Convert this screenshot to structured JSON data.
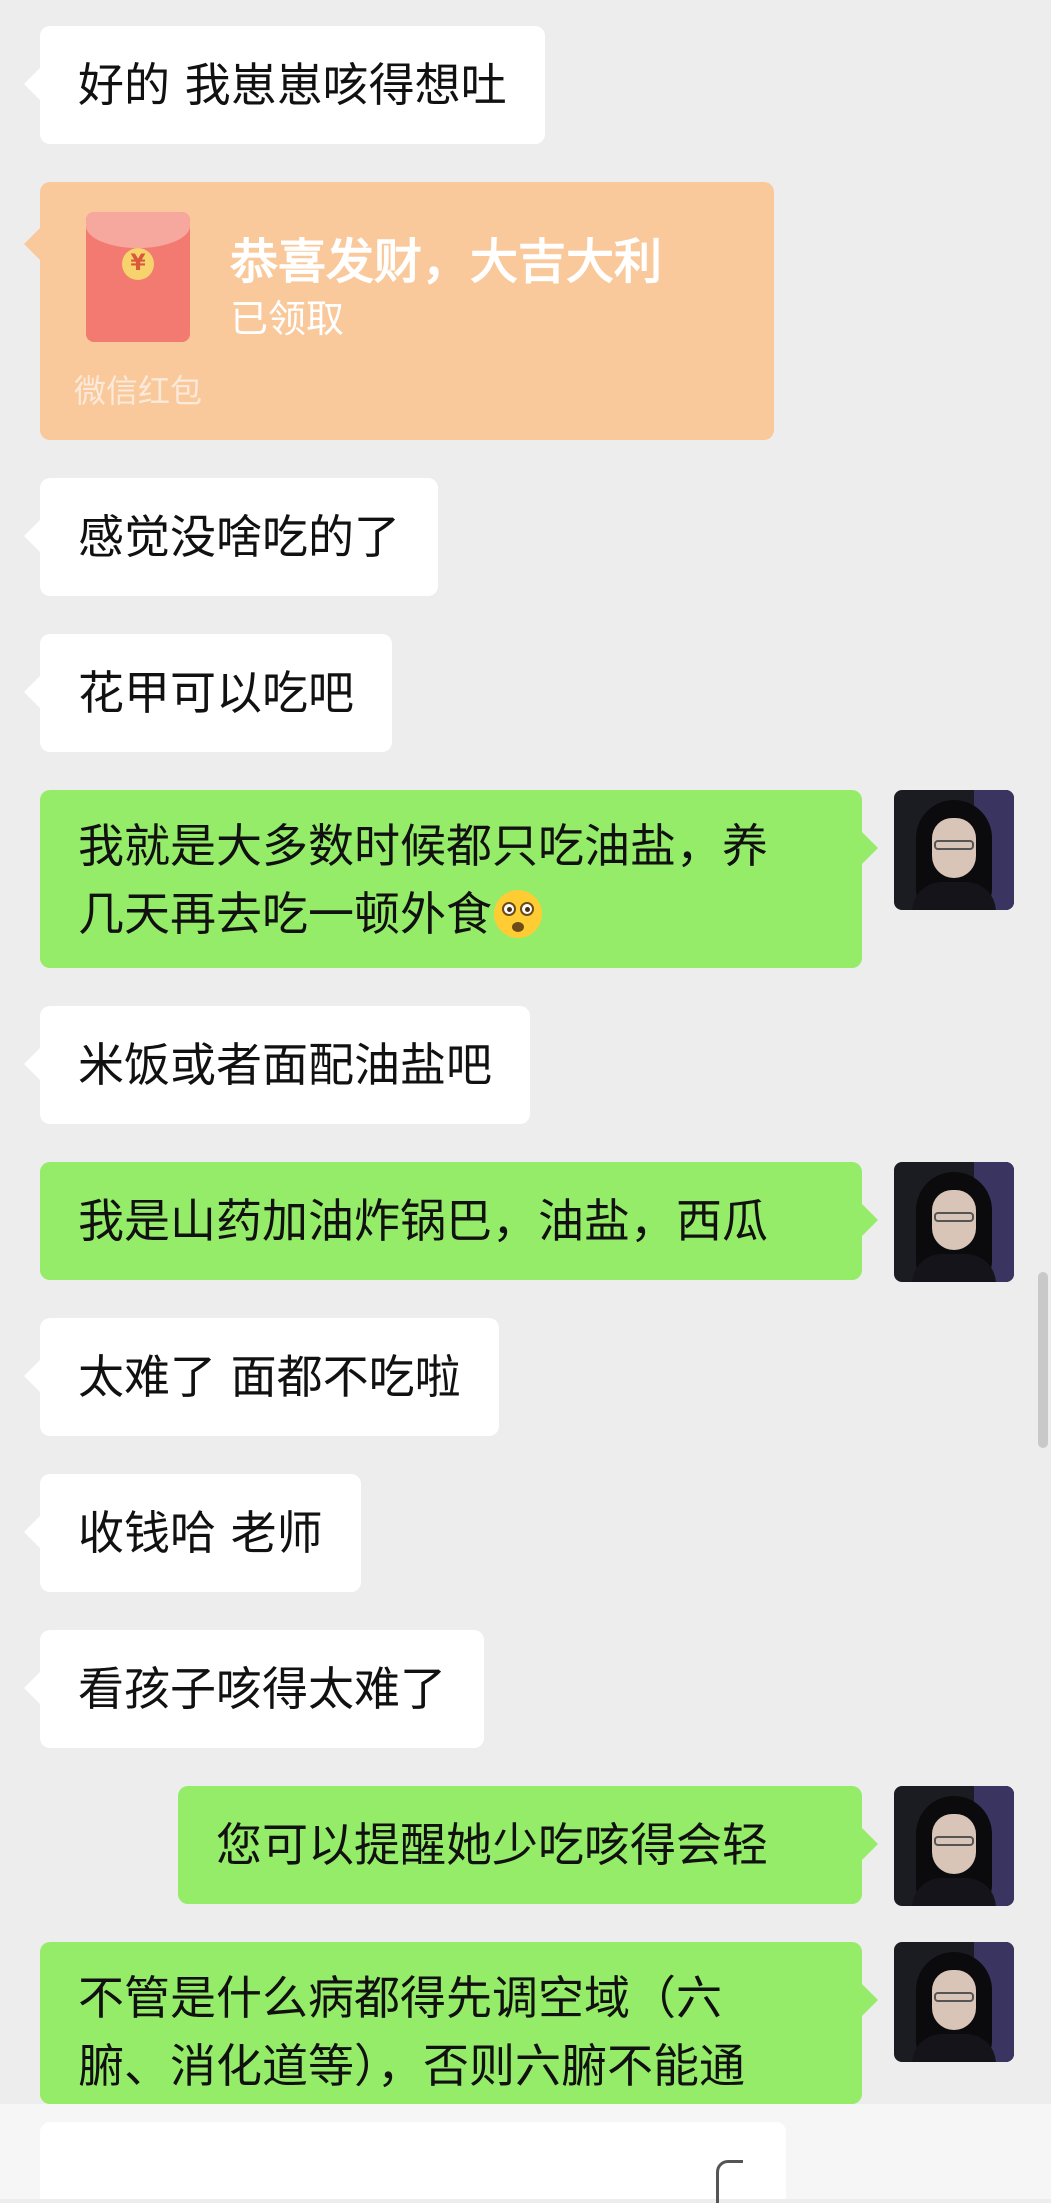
{
  "colors": {
    "background": "#ededed",
    "incoming_bubble": "#ffffff",
    "outgoing_bubble": "#95ec69",
    "red_packet": "#f9c99c"
  },
  "messages": [
    {
      "text": "好的 我崽崽咳得想吐"
    },
    {
      "red_packet": {
        "title": "恭喜发财，大吉大利",
        "status": "已领取",
        "brand": "微信红包"
      }
    },
    {
      "text": "感觉没啥吃的了"
    },
    {
      "text": "花甲可以吃吧"
    },
    {
      "text_line1": "我就是大多数时候都只吃油盐，养",
      "text_line2": "几天再去吃一顿外食",
      "emoji": "flushed-face-emoji"
    },
    {
      "text": "米饭或者面配油盐吧"
    },
    {
      "text": "我是山药加油炸锅巴，油盐，西瓜"
    },
    {
      "text": "太难了 面都不吃啦"
    },
    {
      "text": "收钱哈 老师"
    },
    {
      "text": "看孩子咳得太难了"
    },
    {
      "text": "您可以提醒她少吃咳得会轻"
    },
    {
      "text_line1": "不管是什么病都得先调空域（六",
      "text_line2": "腑、消化道等），否则六腑不能通"
    }
  ]
}
